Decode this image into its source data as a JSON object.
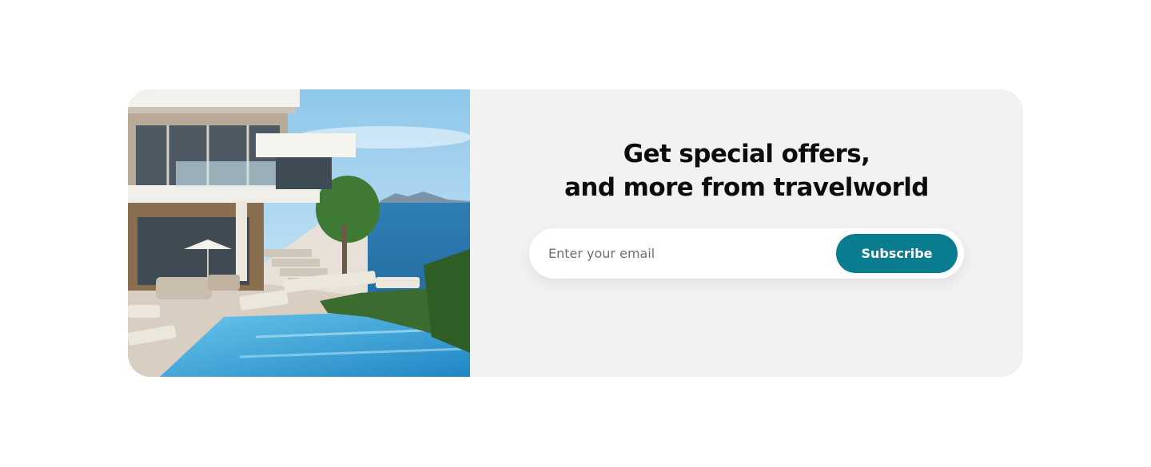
{
  "newsletter": {
    "headline_line1": "Get special offers,",
    "headline_line2": "and more from travelworld",
    "email_placeholder": "Enter your email",
    "subscribe_label": "Subscribe"
  },
  "colors": {
    "accent": "#097d8f",
    "card_background": "#f2f2f2"
  },
  "image": {
    "name": "villa-pool-sea-photo"
  }
}
